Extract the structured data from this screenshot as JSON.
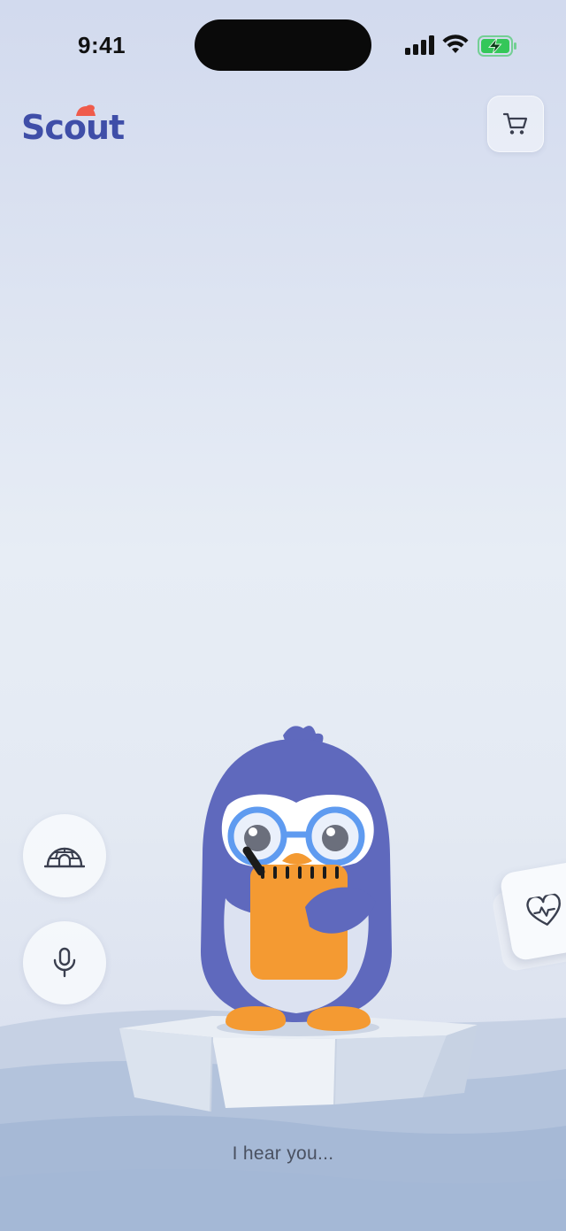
{
  "status_bar": {
    "time": "9:41"
  },
  "header": {
    "logo_text": "Scout",
    "cart_icon": "shopping-cart-icon"
  },
  "side_actions": [
    {
      "icon": "igloo-icon"
    },
    {
      "icon": "microphone-icon"
    }
  ],
  "health_card": {
    "icon": "heart-pulse-icon"
  },
  "mascot": {
    "description_icon": "penguin-mascot"
  },
  "caption": "I hear you...",
  "colors": {
    "brand": "#3f4ea8",
    "accent": "#ef5b4b",
    "penguin_body": "#5f69bd",
    "notepad": "#f49a32"
  }
}
